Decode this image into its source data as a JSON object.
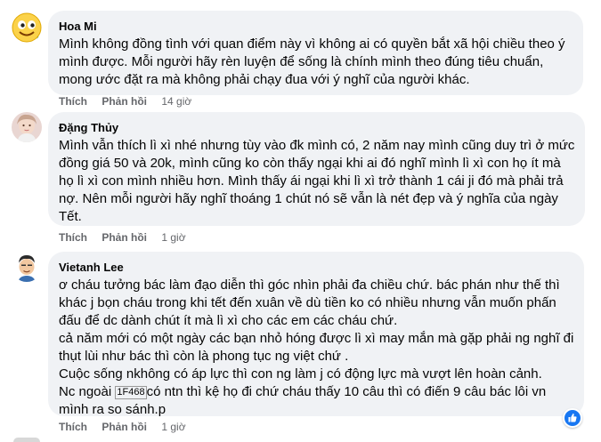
{
  "comments": [
    {
      "author": "Hoa Mi",
      "lines": [
        "Mình không đồng tình với quan điểm này vì không ai có quyền bắt xã hội chiều theo ý",
        "mình được. Mỗi người hãy rèn luyện để sống là chính mình theo đúng tiêu chuẩn,",
        "mong ước đặt ra mà không phải chạy đua với ý nghĩ của người khác."
      ],
      "like": "Thích",
      "reply": "Phản hồi",
      "time": "14 giờ"
    },
    {
      "author": "Đặng Thủy",
      "lines": [
        "Mình vẫn thích lì xì nhé nhưng tùy vào đk mình có, 2 năm nay mình cũng duy trì ở mức",
        "đồng giá 50 và 20k, mình cũng ko còn thấy ngại khi ai đó nghĩ mình lì xì con họ ít mà",
        "họ lì xì con mình nhiều hơn. Mình thấy ái ngại khi lì xì trở thành 1 cái ji đó mà phải trả",
        "nợ. Nên mỗi người hãy nghĩ thoáng 1 chút nó sẽ vẫn là nét đẹp và ý nghĩa của ngày",
        "Tết."
      ],
      "like": "Thích",
      "reply": "Phản hồi",
      "time": "1 giờ"
    },
    {
      "author": "Vietanh Lee",
      "lines": [
        "ơ cháu tưởng bác làm đạo diễn thì góc nhìn phải đa chiều chứ. bác phán như thế thì",
        "khác j bọn cháu trong khi tết đến xuân về dù tiền ko có nhiều nhưng vẫn muốn phấn",
        "đấu để dc dành chút ít mà lì xì cho các em các cháu chứ.",
        "cả năm mới có một ngày các bạn nhỏ hóng được lì xì may mắn mà gặp phải ng nghĩ đi",
        "thụt lùi như bác thì còn là phong tục ng việt chứ .",
        "Cuộc sống nkhông có áp lực thì con ng làm j có động lực mà vượt lên hoàn cảnh.",
        "Nc ngoài",
        "có ntn thì kệ họ đi chứ cháu thấy 10 câu thì có điến 9 câu bác lôi vn",
        "mình ra so sánh.p"
      ],
      "emoji_code": "1F468",
      "like": "Thích",
      "reply": "Phản hồi",
      "time": "1 giờ"
    }
  ],
  "colors": {
    "bubble": "#f0f2f5",
    "text": "#050505",
    "meta": "#65676b",
    "like_badge": "#1877f2"
  },
  "icons": {
    "reaction": "thumbs-up-icon"
  }
}
